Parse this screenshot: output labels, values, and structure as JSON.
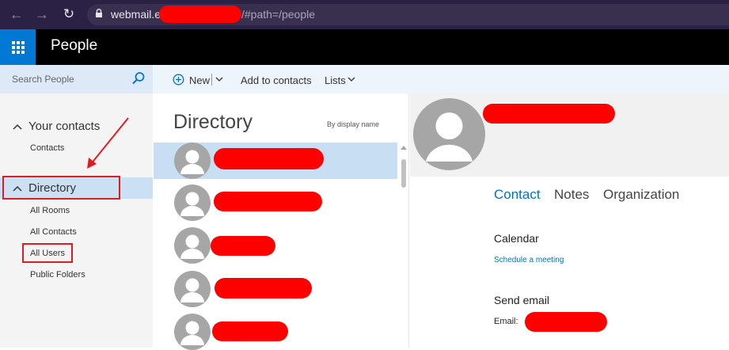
{
  "browser": {
    "url_host": "webmail.e",
    "url_path": "/#path=/people"
  },
  "app": {
    "title": "People"
  },
  "search": {
    "placeholder": "Search People"
  },
  "toolbar": {
    "new_label": "New",
    "add_contacts_label": "Add to contacts",
    "lists_label": "Lists"
  },
  "nav": {
    "your_contacts": {
      "label": "Your contacts",
      "items": [
        "Contacts"
      ]
    },
    "directory": {
      "label": "Directory",
      "items": [
        "All Rooms",
        "All Contacts",
        "All Users",
        "Public Folders"
      ]
    }
  },
  "list": {
    "title": "Directory",
    "sort_label": "By display name"
  },
  "detail": {
    "tabs": [
      "Contact",
      "Notes",
      "Organization"
    ],
    "calendar_heading": "Calendar",
    "schedule_link": "Schedule a meeting",
    "send_email_heading": "Send email",
    "email_label": "Email:"
  },
  "colors": {
    "accent": "#0078d4",
    "redaction": "#ff0000",
    "annotation": "#e11b22"
  },
  "icons": [
    "back-arrow-icon",
    "forward-arrow-icon",
    "reload-icon",
    "lock-icon",
    "app-launcher-icon",
    "search-icon",
    "add-circle-icon",
    "chevron-down-icon",
    "chevron-up-icon",
    "person-avatar-icon"
  ]
}
